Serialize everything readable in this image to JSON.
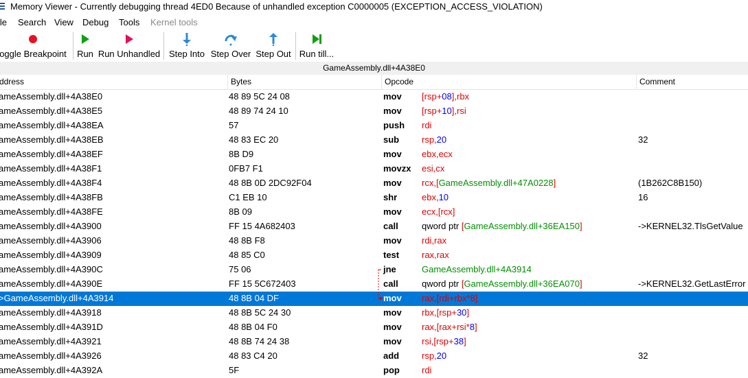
{
  "window": {
    "title": "Memory Viewer - Currently debugging thread 4ED0 Because of unhandled exception C0000005 (EXCEPTION_ACCESS_VIOLATION)",
    "icon": "window-app-icon"
  },
  "menu": {
    "items": [
      {
        "label": "ile",
        "disabled": false
      },
      {
        "label": "Search",
        "disabled": false
      },
      {
        "label": "View",
        "disabled": false
      },
      {
        "label": "Debug",
        "disabled": false
      },
      {
        "label": "Tools",
        "disabled": false
      },
      {
        "label": "Kernel tools",
        "disabled": true
      }
    ]
  },
  "toolbar": {
    "buttons": [
      {
        "label": "oggle Breakpoint",
        "icon": "red-circle-icon",
        "color": "#e81123"
      },
      {
        "label": "Run",
        "icon": "green-play-icon",
        "color": "#10a010"
      },
      {
        "label": "Run Unhandled",
        "icon": "red-play-icon",
        "color": "#e0105a"
      },
      {
        "label": "Step Into",
        "icon": "arrow-down-icon",
        "color": "#2a8ad8"
      },
      {
        "label": "Step Over",
        "icon": "arrow-curve-icon",
        "color": "#2a8ad8"
      },
      {
        "label": "Step Out",
        "icon": "arrow-up-icon",
        "color": "#2a8ad8"
      },
      {
        "label": "Run till...",
        "icon": "run-till-icon",
        "color": "#10a010"
      }
    ]
  },
  "address_bar": {
    "text": "GameAssembly.dll+4A38E0"
  },
  "columns": {
    "address": "ddress",
    "bytes": "Bytes",
    "opcode": "Opcode",
    "comment": "Comment"
  },
  "colors": {
    "selection": "#0078d7",
    "register": "#e00000",
    "number": "#0000ff",
    "symbol": "#009000"
  },
  "rows": [
    {
      "address": "ameAssembly.dll+4A38E0",
      "bytes": "48 89 5C 24 08",
      "opcode": "mov",
      "operands": [
        [
          "reg",
          "["
        ],
        [
          "reg",
          "rsp"
        ],
        [
          "reg",
          "+"
        ],
        [
          "num",
          "08"
        ],
        [
          "reg",
          "],"
        ],
        [
          "reg",
          "rbx"
        ]
      ],
      "comment": ""
    },
    {
      "address": "ameAssembly.dll+4A38E5",
      "bytes": "48 89 74 24 10",
      "opcode": "mov",
      "operands": [
        [
          "reg",
          "["
        ],
        [
          "reg",
          "rsp"
        ],
        [
          "reg",
          "+"
        ],
        [
          "num",
          "10"
        ],
        [
          "reg",
          "],"
        ],
        [
          "reg",
          "rsi"
        ]
      ],
      "comment": ""
    },
    {
      "address": "ameAssembly.dll+4A38EA",
      "bytes": "57",
      "opcode": "push",
      "operands": [
        [
          "reg",
          "rdi"
        ]
      ],
      "comment": ""
    },
    {
      "address": "ameAssembly.dll+4A38EB",
      "bytes": "48 83 EC 20",
      "opcode": "sub",
      "operands": [
        [
          "reg",
          "rsp,"
        ],
        [
          "num",
          "20"
        ]
      ],
      "comment": "32"
    },
    {
      "address": "ameAssembly.dll+4A38EF",
      "bytes": "8B D9",
      "opcode": "mov",
      "operands": [
        [
          "reg",
          "ebx,ecx"
        ]
      ],
      "comment": ""
    },
    {
      "address": "ameAssembly.dll+4A38F1",
      "bytes": "0FB7 F1",
      "opcode": "movzx",
      "operands": [
        [
          "reg",
          "esi,cx"
        ]
      ],
      "comment": ""
    },
    {
      "address": "ameAssembly.dll+4A38F4",
      "bytes": "48 8B 0D 2DC92F04",
      "opcode": "mov",
      "operands": [
        [
          "reg",
          "rcx,["
        ],
        [
          "sym",
          "GameAssembly.dll+47A0228"
        ],
        [
          "reg",
          "]"
        ]
      ],
      "comment": "(1B262C8B150)"
    },
    {
      "address": "ameAssembly.dll+4A38FB",
      "bytes": "C1 EB 10",
      "opcode": "shr",
      "operands": [
        [
          "reg",
          "ebx,"
        ],
        [
          "num",
          "10"
        ]
      ],
      "comment": "16"
    },
    {
      "address": "ameAssembly.dll+4A38FE",
      "bytes": "8B 09",
      "opcode": "mov",
      "operands": [
        [
          "reg",
          "ecx,[rcx]"
        ]
      ],
      "comment": ""
    },
    {
      "address": "ameAssembly.dll+4A3900",
      "bytes": "FF 15 4A682403",
      "opcode": "call",
      "operands": [
        [
          "pln",
          "qword ptr "
        ],
        [
          "reg",
          "["
        ],
        [
          "sym",
          "GameAssembly.dll+36EA150"
        ],
        [
          "reg",
          "]"
        ]
      ],
      "comment": "->KERNEL32.TlsGetValue"
    },
    {
      "address": "ameAssembly.dll+4A3906",
      "bytes": "48 8B F8",
      "opcode": "mov",
      "operands": [
        [
          "reg",
          "rdi,rax"
        ]
      ],
      "comment": ""
    },
    {
      "address": "ameAssembly.dll+4A3909",
      "bytes": "48 85 C0",
      "opcode": "test",
      "operands": [
        [
          "reg",
          "rax,rax"
        ]
      ],
      "comment": ""
    },
    {
      "address": "ameAssembly.dll+4A390C",
      "bytes": "75 06",
      "opcode": "jne",
      "operands": [
        [
          "sym",
          "GameAssembly.dll+4A3914"
        ]
      ],
      "comment": ""
    },
    {
      "address": "ameAssembly.dll+4A390E",
      "bytes": "FF 15 5C672403",
      "opcode": "call",
      "operands": [
        [
          "pln",
          "qword ptr "
        ],
        [
          "reg",
          "["
        ],
        [
          "sym",
          "GameAssembly.dll+36EA070"
        ],
        [
          "reg",
          "]"
        ]
      ],
      "comment": "->KERNEL32.GetLastError"
    },
    {
      "address": ">GameAssembly.dll+4A3914",
      "bytes": "48 8B 04 DF",
      "opcode": "mov",
      "operands": [
        [
          "reg",
          "rax,["
        ],
        [
          "reg",
          "rdi"
        ],
        [
          "reg",
          "+"
        ],
        [
          "reg",
          "rbx"
        ],
        [
          "reg",
          "*"
        ],
        [
          "num",
          "8"
        ],
        [
          "reg",
          "]"
        ]
      ],
      "comment": "",
      "selected": true
    },
    {
      "address": "ameAssembly.dll+4A3918",
      "bytes": "48 8B 5C 24 30",
      "opcode": "mov",
      "operands": [
        [
          "reg",
          "rbx,["
        ],
        [
          "reg",
          "rsp"
        ],
        [
          "reg",
          "+"
        ],
        [
          "num",
          "30"
        ],
        [
          "reg",
          "]"
        ]
      ],
      "comment": ""
    },
    {
      "address": "ameAssembly.dll+4A391D",
      "bytes": "48 8B 04 F0",
      "opcode": "mov",
      "operands": [
        [
          "reg",
          "rax,["
        ],
        [
          "reg",
          "rax"
        ],
        [
          "reg",
          "+"
        ],
        [
          "reg",
          "rsi"
        ],
        [
          "reg",
          "*"
        ],
        [
          "num",
          "8"
        ],
        [
          "reg",
          "]"
        ]
      ],
      "comment": ""
    },
    {
      "address": "ameAssembly.dll+4A3921",
      "bytes": "48 8B 74 24 38",
      "opcode": "mov",
      "operands": [
        [
          "reg",
          "rsi,["
        ],
        [
          "reg",
          "rsp"
        ],
        [
          "reg",
          "+"
        ],
        [
          "num",
          "38"
        ],
        [
          "reg",
          "]"
        ]
      ],
      "comment": ""
    },
    {
      "address": "ameAssembly.dll+4A3926",
      "bytes": "48 83 C4 20",
      "opcode": "add",
      "operands": [
        [
          "reg",
          "rsp,"
        ],
        [
          "num",
          "20"
        ]
      ],
      "comment": "32"
    },
    {
      "address": "ameAssembly.dll+4A392A",
      "bytes": "5F",
      "opcode": "pop",
      "operands": [
        [
          "reg",
          "rdi"
        ]
      ],
      "comment": ""
    }
  ]
}
